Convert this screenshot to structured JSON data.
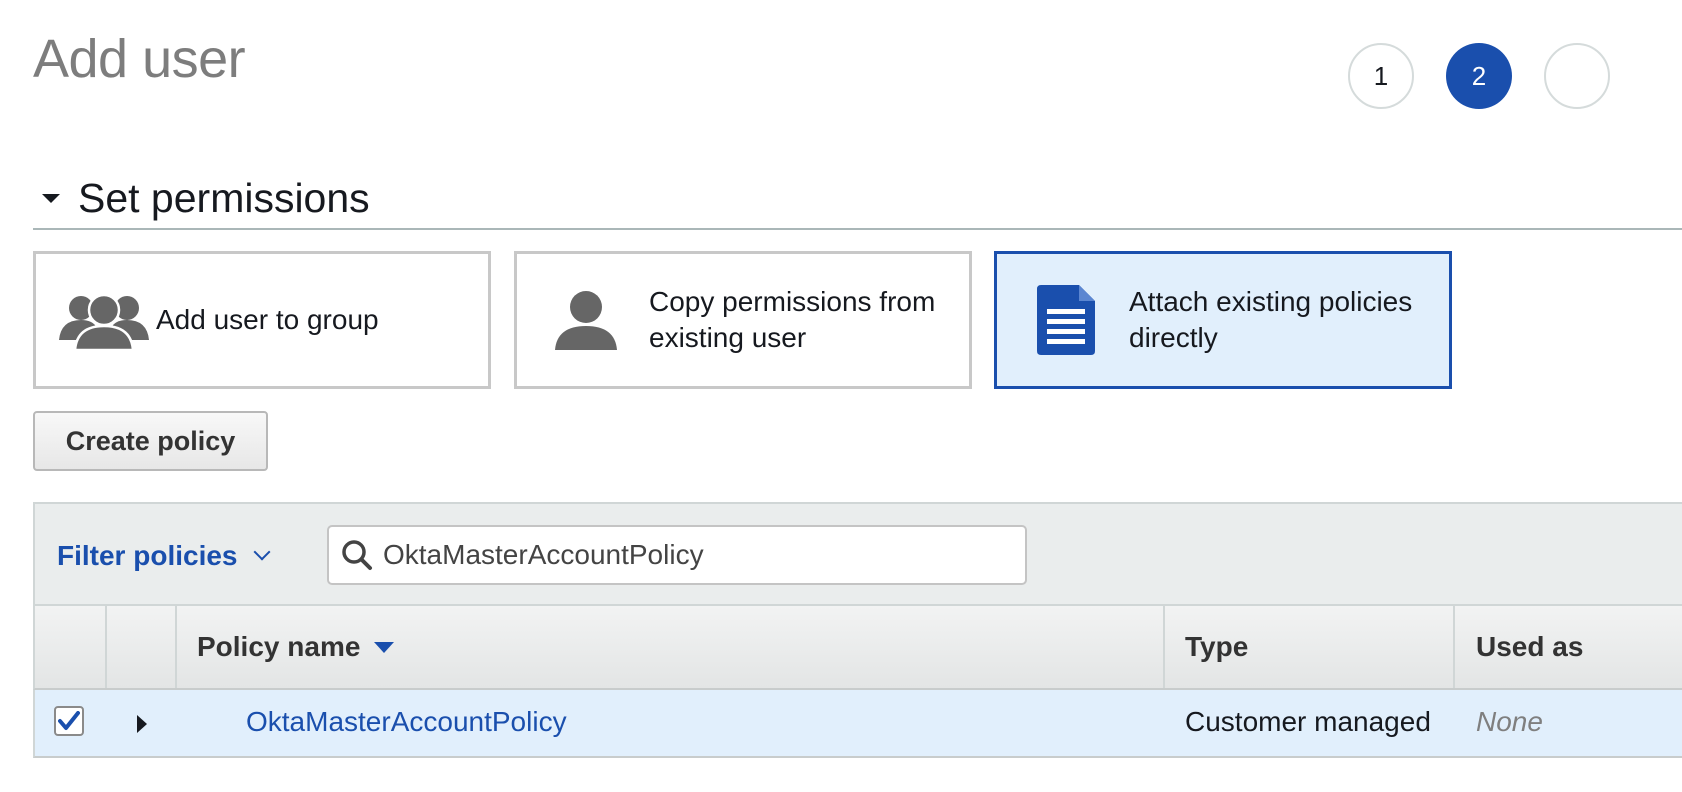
{
  "page": {
    "title": "Add user"
  },
  "wizard": {
    "steps": [
      {
        "label": "1",
        "state": "inactive"
      },
      {
        "label": "2",
        "state": "active"
      },
      {
        "label": "",
        "state": "inactive"
      }
    ]
  },
  "section": {
    "title": "Set permissions"
  },
  "permission_options": [
    {
      "label": "Add user to group",
      "icon": "group-icon",
      "selected": false
    },
    {
      "label": "Copy permissions from existing user",
      "icon": "user-icon",
      "selected": false
    },
    {
      "label": "Attach existing policies directly",
      "icon": "document-icon",
      "selected": true
    }
  ],
  "toolbar": {
    "create_policy_label": "Create policy"
  },
  "filter": {
    "dropdown_label": "Filter policies",
    "search_value": "OktaMasterAccountPolicy"
  },
  "table": {
    "columns": [
      "Policy name",
      "Type",
      "Used as"
    ],
    "sorted_column": "Policy name",
    "rows": [
      {
        "checked": true,
        "policy_name": "OktaMasterAccountPolicy",
        "type": "Customer managed",
        "used_as": "None"
      }
    ]
  },
  "colors": {
    "accent": "#1a4fad",
    "selected_background": "#e1effc",
    "title_gray": "#7d7d7d"
  }
}
